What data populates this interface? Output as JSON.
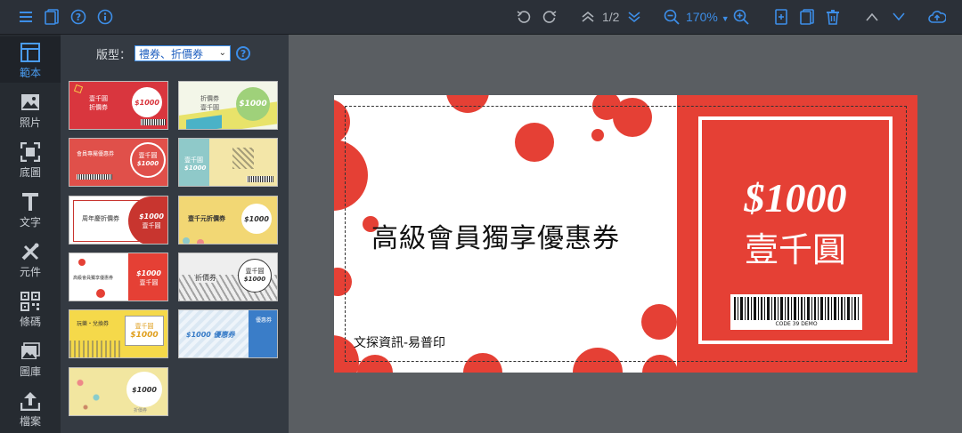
{
  "toolbar": {
    "page_indicator": "1/2",
    "zoom": "170%"
  },
  "sidebar": {
    "items": [
      {
        "label": "範本",
        "icon": "template-icon"
      },
      {
        "label": "照片",
        "icon": "photo-icon"
      },
      {
        "label": "底圖",
        "icon": "background-icon"
      },
      {
        "label": "文字",
        "icon": "text-icon"
      },
      {
        "label": "元件",
        "icon": "component-icon"
      },
      {
        "label": "條碼",
        "icon": "barcode-icon"
      },
      {
        "label": "圖庫",
        "icon": "gallery-icon"
      },
      {
        "label": "檔案",
        "icon": "file-upload-icon"
      }
    ]
  },
  "panel": {
    "type_label": "版型：",
    "type_value": "禮券、折價券"
  },
  "thumbnails": [
    {
      "text1": "壹千圓",
      "text2": "折價券",
      "price": "$1000",
      "color": "#d9363e"
    },
    {
      "text1": "折價券",
      "text2": "壹千圓",
      "price": "$1000",
      "color": "#9fd17a"
    },
    {
      "text1": "會員專屬優惠券",
      "text2": "壹千圓",
      "price": "$1000",
      "color": "#e0504a"
    },
    {
      "text1": "壹千圓",
      "text2": "",
      "price": "$1000",
      "color": "#f3e6a8"
    },
    {
      "text1": "周年慶折價券",
      "text2": "壹千圓",
      "price": "$1000",
      "color": "#c8352f"
    },
    {
      "text1": "壹千元折價券",
      "text2": "",
      "price": "$1000",
      "color": "#f2d774"
    },
    {
      "text1": "高級會員獨享優惠券",
      "text2": "壹千圓",
      "price": "$1000",
      "color": "#e54035"
    },
    {
      "text1": "折價券",
      "text2": "壹千圓",
      "price": "$1000",
      "color": "#e8e8e8"
    },
    {
      "text1": "玩樂・兌換券",
      "text2": "壹千圓",
      "price": "$1000",
      "color": "#f5d94a"
    },
    {
      "text1": "$1000 優惠券",
      "text2": "優惠券",
      "price": "",
      "color": "#3a7dc8"
    },
    {
      "text1": "",
      "text2": "折價券",
      "price": "$1000",
      "color": "#f2e6a0"
    }
  ],
  "voucher": {
    "title": "高級會員獨享優惠券",
    "company": "文探資訊-易普印",
    "price": "$1000",
    "amount_text": "壹千圓",
    "barcode_text": "CODE 39 DEMO",
    "accent_color": "#e54035"
  }
}
